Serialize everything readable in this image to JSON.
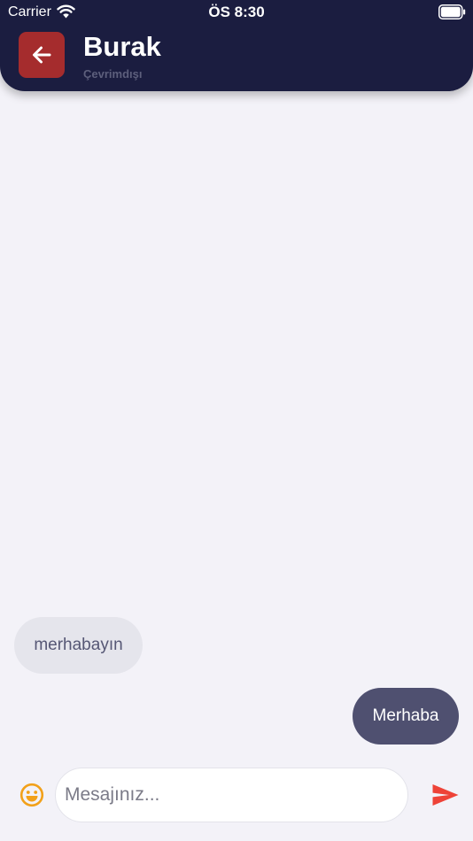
{
  "status_bar": {
    "carrier": "Carrier",
    "time": "ÖS 8:30"
  },
  "header": {
    "contact_name": "Burak",
    "contact_status": "Çevrimdışı",
    "back_icon": "arrow-left-icon"
  },
  "messages": [
    {
      "direction": "received",
      "text": "merhabayın"
    },
    {
      "direction": "sent",
      "text": "Merhaba"
    }
  ],
  "composer": {
    "placeholder": "Mesajınız...",
    "value": "",
    "emoji_icon": "smiley-icon",
    "send_icon": "send-icon"
  },
  "colors": {
    "header_bg": "#1b1d40",
    "back_button_bg": "#a52c2d",
    "received_bubble": "#e5e5ec",
    "sent_bubble": "#4f5070",
    "emoji_accent": "#f2a11a",
    "send_accent": "#ee4338",
    "background": "#f3f2f8"
  }
}
